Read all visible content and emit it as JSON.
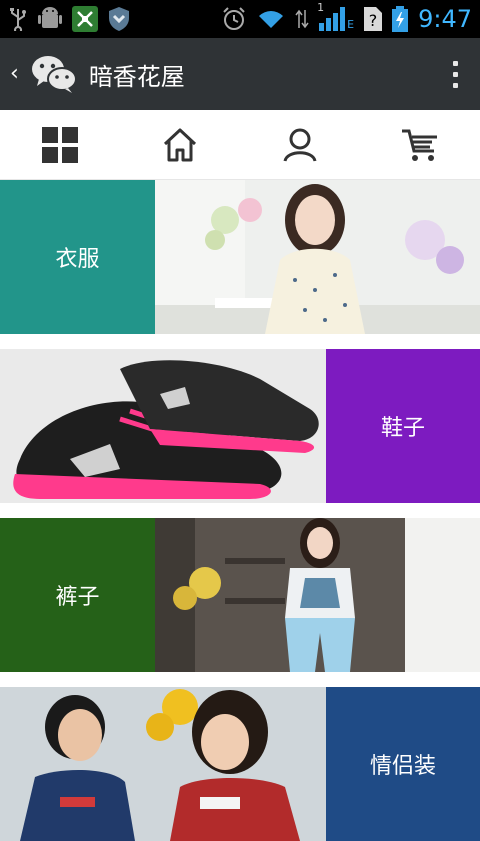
{
  "status_bar": {
    "time": "9:47",
    "network_label": "E",
    "signal_sub": "1",
    "icons": [
      "usb-icon",
      "android-debug-icon",
      "network-tool-icon",
      "shield-icon",
      "alarm-icon",
      "wifi-icon",
      "signal-icon",
      "unknown-sim-icon",
      "battery-icon"
    ]
  },
  "app_bar": {
    "back_label": "‹",
    "title": "暗香花屋",
    "icons": [
      "back-icon",
      "wechat-icon",
      "more-options-icon"
    ]
  },
  "nav_tabs": [
    {
      "name": "grid",
      "icon": "grid-icon"
    },
    {
      "name": "home",
      "icon": "home-icon"
    },
    {
      "name": "user",
      "icon": "user-icon"
    },
    {
      "name": "cart",
      "icon": "cart-icon"
    }
  ],
  "categories": [
    {
      "label": "衣服",
      "color": "#22958a",
      "label_side": "left"
    },
    {
      "label": "鞋子",
      "color": "#7d1bc0",
      "label_side": "right"
    },
    {
      "label": "裤子",
      "color": "#256118",
      "label_side": "left"
    },
    {
      "label": "情侣装",
      "color": "#1f4b86",
      "label_side": "right"
    }
  ],
  "colors": {
    "status_bar_bg": "#000000",
    "time": "#40b7ff",
    "app_bar_bg": "#2f3336",
    "nav_icon": "#333333"
  }
}
